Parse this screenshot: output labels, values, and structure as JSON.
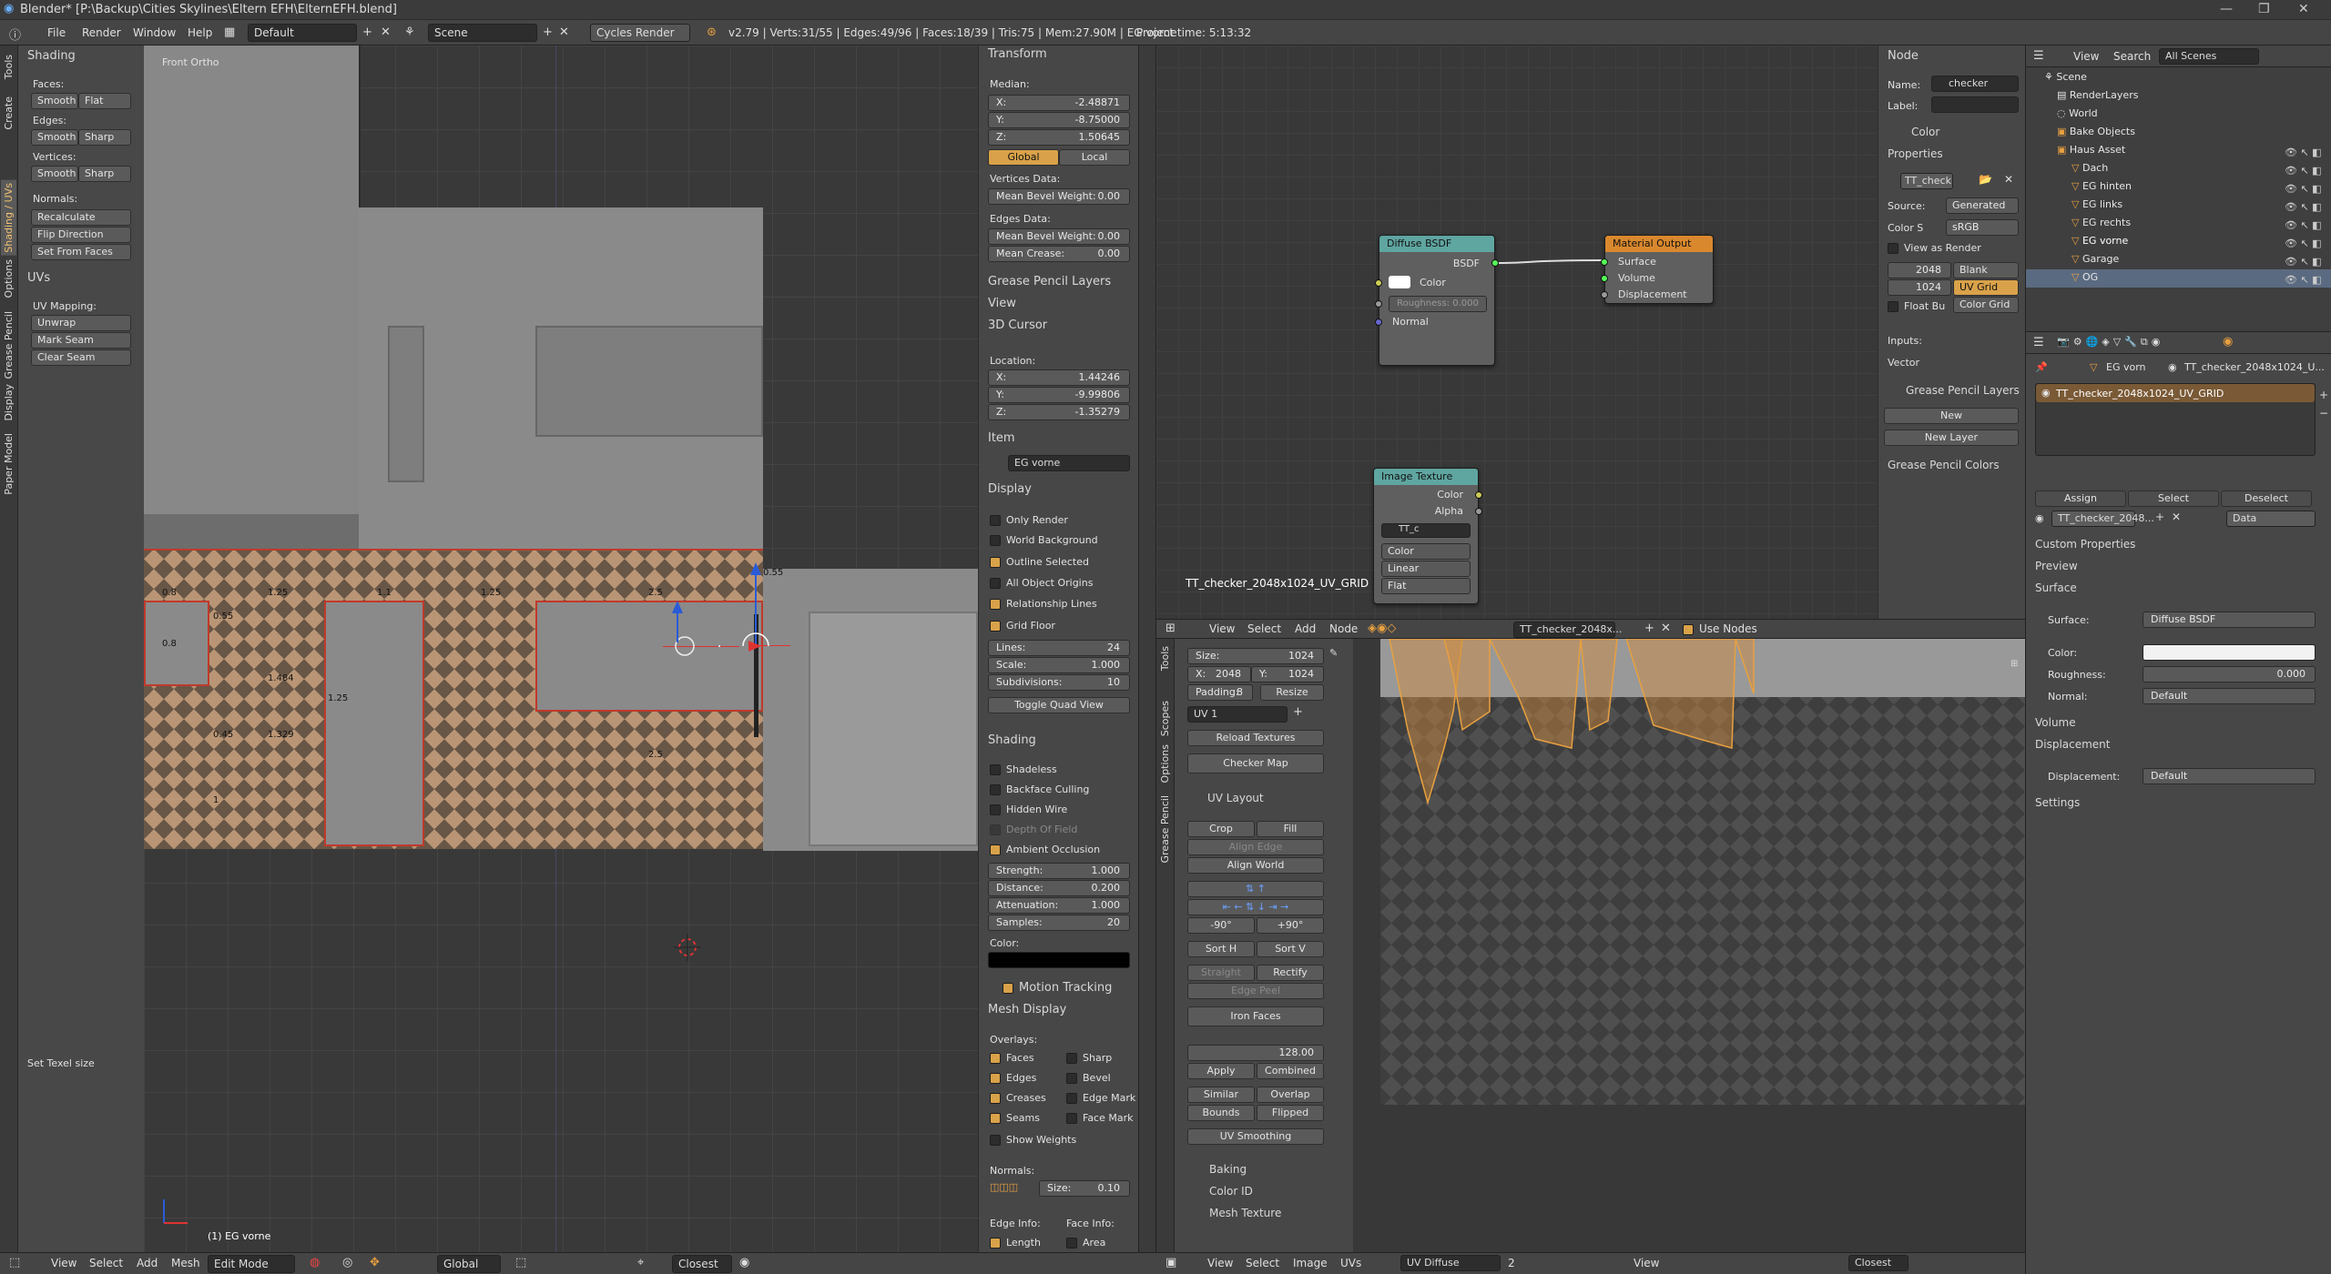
{
  "title": "Blender* [P:\\Backup\\Cities Skylines\\Eltern EFH\\ElternEFH.blend]",
  "menu": {
    "file": "File",
    "render": "Render",
    "window": "Window",
    "help": "Help",
    "layout": "Default",
    "scene": "Scene",
    "engine": "Cycles Render",
    "stats": "v2.79 | Verts:31/55 | Edges:49/96 | Faces:18/39 | Tris:75 | Mem:27.90M | EG vorne",
    "project_time": "Project time: 5:13:32"
  },
  "tool_tabs": [
    "Tools",
    "Create",
    "Shading / UVs",
    "Options",
    "Grease Pencil",
    "Display",
    "Paper Model"
  ],
  "tools": {
    "shading_header": "Shading",
    "faces": "Faces:",
    "smooth": "Smooth",
    "flat": "Flat",
    "edges": "Edges:",
    "sharp": "Sharp",
    "vertices": "Vertices:",
    "normals": "Normals:",
    "recalculate": "Recalculate",
    "flip": "Flip Direction",
    "set_from_faces": "Set From Faces",
    "uvs_header": "UVs",
    "uv_mapping": "UV Mapping:",
    "unwrap": "Unwrap",
    "mark_seam": "Mark Seam",
    "clear_seam": "Clear Seam",
    "texel": "Set Texel size"
  },
  "viewport": {
    "label": "Front Ortho",
    "object": "(1) EG vorne",
    "dims": [
      "0.8",
      "1.25",
      "0.55",
      "1.1",
      "1.25",
      "2.5",
      "0.8",
      "1.484",
      "1.25",
      "1.329",
      "0.45",
      "1",
      "2.5",
      "0.55"
    ],
    "footer": {
      "view": "View",
      "select": "Select",
      "add": "Add",
      "mesh": "Mesh",
      "mode": "Edit Mode",
      "orientation": "Global",
      "snap": "Closest"
    }
  },
  "npanel": {
    "transform": "Transform",
    "median": "Median:",
    "x_label": "X:",
    "x": "-2.48871",
    "y_label": "Y:",
    "y": "-8.75000",
    "z_label": "Z:",
    "z": "1.50645",
    "global": "Global",
    "local": "Local",
    "vertices_data": "Vertices Data:",
    "mbw": "Mean Bevel Weight:",
    "mbw_v": "0.00",
    "edges_data": "Edges Data:",
    "mbw2": "Mean Bevel Weight:",
    "mbw2_v": "0.00",
    "mean_crease": "Mean Crease:",
    "mean_crease_v": "0.00",
    "gp_layers": "Grease Pencil Layers",
    "view": "View",
    "cursor": "3D Cursor",
    "location": "Location:",
    "cx": "1.44246",
    "cy": "-9.99806",
    "cz": "-1.35279",
    "item": "Item",
    "item_name": "EG vorne",
    "display": "Display",
    "only_render": "Only Render",
    "world_bg": "World Background",
    "outline_sel": "Outline Selected",
    "all_origins": "All Object Origins",
    "rel_lines": "Relationship Lines",
    "grid_floor": "Grid Floor",
    "lines": "Lines:",
    "lines_v": "24",
    "scale": "Scale:",
    "scale_v": "1.000",
    "subdiv": "Subdivisions:",
    "subdiv_v": "10",
    "toggle_quad": "Toggle Quad View",
    "shading": "Shading",
    "shadeless": "Shadeless",
    "backface": "Backface Culling",
    "hidden_wire": "Hidden Wire",
    "dof": "Depth Of Field",
    "ao": "Ambient Occlusion",
    "strength": "Strength:",
    "strength_v": "1.000",
    "distance": "Distance:",
    "distance_v": "0.200",
    "attenuation": "Attenuation:",
    "attenuation_v": "1.000",
    "samples": "Samples:",
    "samples_v": "20",
    "color": "Color:",
    "motion": "Motion Tracking",
    "mesh_display": "Mesh Display",
    "overlays": "Overlays:",
    "ov_faces": "Faces",
    "ov_sharp": "Sharp",
    "ov_edges": "Edges",
    "ov_bevel": "Bevel",
    "ov_creases": "Creases",
    "ov_edge_mark": "Edge Mark",
    "ov_seams": "Seams",
    "ov_face_mark": "Face Mark",
    "show_weights": "Show Weights",
    "normals": "Normals:",
    "size": "Size:",
    "size_v": "0.10",
    "edge_info": "Edge Info:",
    "face_info": "Face Info:",
    "length": "Length",
    "area": "Area"
  },
  "nodes": {
    "diffuse": "Diffuse BSDF",
    "bsdf": "BSDF",
    "color": "Color",
    "roughness": "Roughness: 0.000",
    "normal": "Normal",
    "output": "Material Output",
    "surface": "Surface",
    "volume": "Volume",
    "displacement": "Displacement",
    "image_tex": "Image Texture",
    "alpha": "Alpha",
    "img_name": "TT_c",
    "color_sel": "Color",
    "linear": "Linear",
    "flat": "Flat",
    "material_label": "TT_checker_2048x1024_UV_GRID",
    "header": {
      "view": "View",
      "select": "Select",
      "add": "Add",
      "node": "Node",
      "mat": "TT_checker_2048x...",
      "use_nodes": "Use Nodes"
    }
  },
  "node_panel": {
    "node": "Node",
    "name_l": "Name:",
    "name_v": "checker",
    "label_l": "Label:",
    "color": "Color",
    "properties": "Properties",
    "img": "TT_check",
    "source": "Source:",
    "source_v": "Generated",
    "colors": "Color S",
    "colors_v": "sRGB",
    "view_render": "View as Render",
    "w": "2048",
    "h": "1024",
    "blank": "Blank",
    "uvgrid": "UV Grid",
    "floatbu": "Float Bu",
    "colorgrid": "Color Grid",
    "inputs": "Inputs:",
    "vector": "Vector",
    "gp_layers": "Grease Pencil Layers",
    "new": "New",
    "new_layer": "New Layer",
    "gp_colors": "Grease Pencil Colors"
  },
  "uvtools": {
    "tabs": [
      "Tools",
      "Scopes",
      "Options",
      "Grease Pencil"
    ],
    "size_l": "Size:",
    "size_v": "1024",
    "x_l": "X:",
    "x_v": "2048",
    "y_l": "Y:",
    "y_v": "1024",
    "padding": "Padding:",
    "padding_v": "8",
    "resize": "Resize",
    "uvmap": "UV 1",
    "reload": "Reload Textures",
    "checker": "Checker Map",
    "uv_layout": "UV Layout",
    "crop": "Crop",
    "fill": "Fill",
    "align_edge": "Align Edge",
    "align_world": "Align World",
    "neg90": "-90°",
    "pos90": "+90°",
    "sort_h": "Sort H",
    "sort_v": "Sort V",
    "straight": "Straight",
    "rectify": "Rectify",
    "edge_peel": "Edge Peel",
    "iron": "Iron Faces",
    "val128": "128.00",
    "apply": "Apply",
    "combined": "Combined",
    "similar": "Similar",
    "overlap": "Overlap",
    "bounds": "Bounds",
    "flipped": "Flipped",
    "smoothing": "UV Smoothing",
    "baking": "Baking",
    "color_id": "Color ID",
    "mesh_tex": "Mesh Texture",
    "footer": {
      "view": "View",
      "select": "Select",
      "image": "Image",
      "uvs": "UVs",
      "uv_diffuse": "UV Diffuse",
      "count": "2",
      "view2": "View",
      "snap": "Closest"
    }
  },
  "outliner": {
    "header": {
      "view": "View",
      "search": "Search",
      "all": "All Scenes"
    },
    "rows": [
      "Scene",
      "RenderLayers",
      "World",
      "Bake Objects",
      "Haus Asset",
      "Dach",
      "EG hinten",
      "EG links",
      "EG rechts",
      "EG vorne",
      "Garage",
      "OG"
    ]
  },
  "props": {
    "obj": "EG vorn",
    "mat_path": "TT_checker_2048x1024_U...",
    "slot": "TT_checker_2048x1024_UV_GRID",
    "assign": "Assign",
    "select": "Select",
    "deselect": "Deselect",
    "mat_field": "TT_checker_2048...",
    "data": "Data",
    "custom": "Custom Properties",
    "preview": "Preview",
    "surface_h": "Surface",
    "surface_l": "Surface:",
    "surface_v": "Diffuse BSDF",
    "color_l": "Color:",
    "rough_l": "Roughness:",
    "rough_v": "0.000",
    "normal_l": "Normal:",
    "normal_v": "Default",
    "volume": "Volume",
    "displacement_h": "Displacement",
    "disp_l": "Displacement:",
    "disp_v": "Default",
    "settings": "Settings"
  }
}
